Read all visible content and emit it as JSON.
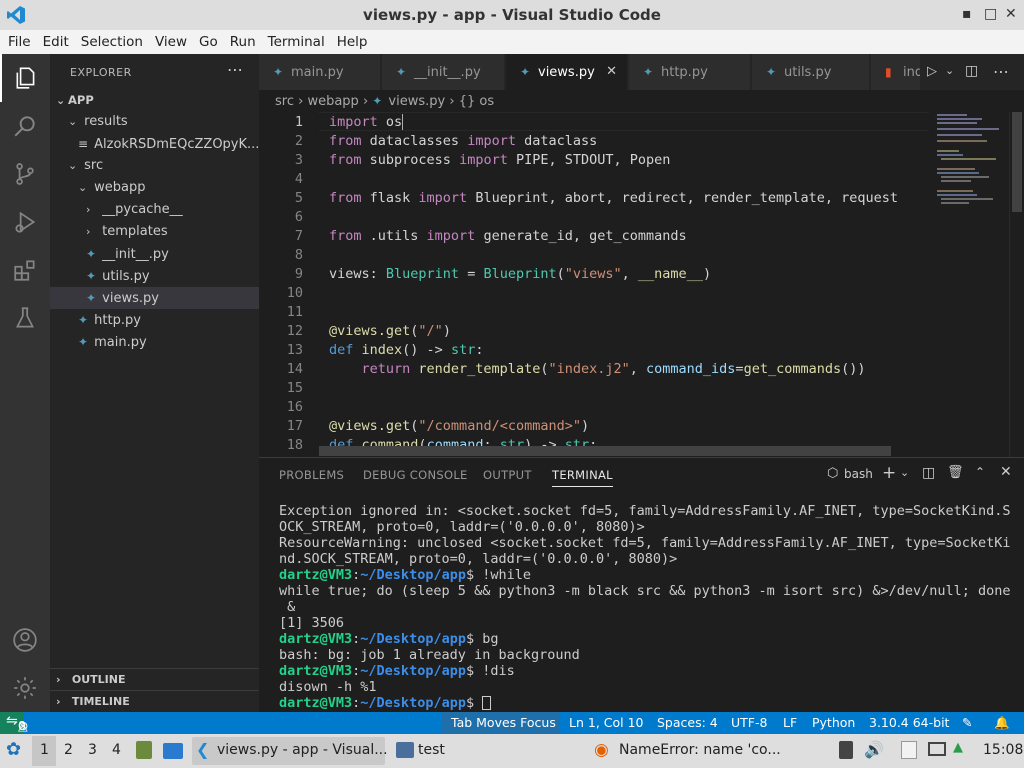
{
  "window": {
    "title": "views.py - app - Visual Studio Code"
  },
  "menu": [
    "File",
    "Edit",
    "Selection",
    "View",
    "Go",
    "Run",
    "Terminal",
    "Help"
  ],
  "explorer": {
    "header": "EXPLORER",
    "root": "APP",
    "items": [
      {
        "label": "results",
        "type": "folder",
        "open": true,
        "depth": 1
      },
      {
        "label": "AlzokRSDmEQcZZOpyK...",
        "type": "file",
        "depth": 2
      },
      {
        "label": "src",
        "type": "folder",
        "open": true,
        "depth": 1
      },
      {
        "label": "webapp",
        "type": "folder",
        "open": true,
        "depth": 2
      },
      {
        "label": "__pycache__",
        "type": "folder",
        "open": false,
        "depth": 3
      },
      {
        "label": "templates",
        "type": "folder",
        "open": false,
        "depth": 3
      },
      {
        "label": "__init__.py",
        "type": "py",
        "depth": 3
      },
      {
        "label": "utils.py",
        "type": "py",
        "depth": 3
      },
      {
        "label": "views.py",
        "type": "py",
        "depth": 3,
        "selected": true
      },
      {
        "label": "http.py",
        "type": "py",
        "depth": 2
      },
      {
        "label": "main.py",
        "type": "py",
        "depth": 2
      }
    ],
    "outline": "OUTLINE",
    "timeline": "TIMELINE"
  },
  "tabs": [
    "main.py",
    "__init__.py",
    "views.py",
    "http.py",
    "utils.py",
    "ind"
  ],
  "breadcrumb": {
    "a": "src",
    "b": "webapp",
    "c": "views.py",
    "d": "{} os"
  },
  "editor": {
    "line_numbers": [
      "1",
      "2",
      "3",
      "4",
      "5",
      "6",
      "7",
      "8",
      "9",
      "10",
      "11",
      "12",
      "13",
      "14",
      "15",
      "16",
      "17",
      "18"
    ],
    "lines": {
      "l1a": "import",
      "l1b": " os",
      "l2a": "from",
      "l2b": " dataclasses ",
      "l2c": "import",
      "l2d": " dataclass",
      "l3a": "from",
      "l3b": " subprocess ",
      "l3c": "import",
      "l3d": " PIPE, STDOUT, Popen",
      "l5a": "from",
      "l5b": " flask ",
      "l5c": "import",
      "l5d": " Blueprint, abort, redirect, render_template, request",
      "l7a": "from",
      "l7b": " .utils ",
      "l7c": "import",
      "l7d": " generate_id, get_commands",
      "l9a": "views: ",
      "l9b": "Blueprint",
      "l9c": " = ",
      "l9d": "Blueprint",
      "l9e": "(",
      "l9f": "\"views\"",
      "l9g": ", ",
      "l9h": "__name__",
      "l9i": ")",
      "l12a": "@views.get",
      "l12b": "(",
      "l12c": "\"/\"",
      "l12d": ")",
      "l13a": "def",
      "l13b": " index",
      "l13c": "() -> ",
      "l13d": "str",
      ":": ":",
      "l14a": "    return ",
      "l14b": "render_template",
      "l14c": "(",
      "l14d": "\"index.j2\"",
      "l14e": ", ",
      "l14f": "command_ids",
      "l14g": "=",
      "l14h": "get_commands",
      "l14i": "())",
      "l17a": "@views.get",
      "l17b": "(",
      "l17c": "\"/command/<command>\"",
      "l17d": ")",
      "l18a": "def",
      "l18b": " command",
      "l18c": "(",
      "l18d": "command",
      "l18e": ": ",
      "l18f": "str",
      "l18g": ") -> ",
      "l18h": "str",
      "l18i": ":"
    }
  },
  "panel": {
    "tabs": [
      "PROBLEMS",
      "DEBUG CONSOLE",
      "OUTPUT",
      "TERMINAL"
    ],
    "shell": "bash",
    "terminal": {
      "t1": "Exception ignored in: <socket.socket fd=5, family=AddressFamily.AF_INET, type=SocketKind.S",
      "t2": "OCK_STREAM, proto=0, laddr=('0.0.0.0', 8080)>",
      "t3": "ResourceWarning: unclosed <socket.socket fd=5, family=AddressFamily.AF_INET, type=SocketKi",
      "t4": "nd.SOCK_STREAM, proto=0, laddr=('0.0.0.0', 8080)>",
      "prompt_user": "dartz@VM3",
      "prompt_path": "~/Desktop/app",
      "c1": "$ !while",
      "t6": "while true; do (sleep 5 && python3 -m black src && python3 -m isort src) &>/dev/null; done",
      "t7": " &",
      "t8": "[1] 3506",
      "c2": "$ bg",
      "t10": "bash: bg: job 1 already in background",
      "c3": "$ !dis",
      "t12": "disown -h %1",
      "c4": "$ "
    }
  },
  "status": {
    "errors": "0",
    "warnings": "0",
    "focus": "Tab Moves Focus",
    "position": "Ln 1, Col 10",
    "spaces": "Spaces: 4",
    "encoding": "UTF-8",
    "eol": "LF",
    "language": "Python",
    "interpreter": "3.10.4 64-bit"
  },
  "taskbar": {
    "workspaces": [
      "1",
      "2",
      "3",
      "4"
    ],
    "vscode": "views.py - app - Visual...",
    "folder": "test",
    "firefox": "NameError: name 'co...",
    "clock": "15:08"
  }
}
